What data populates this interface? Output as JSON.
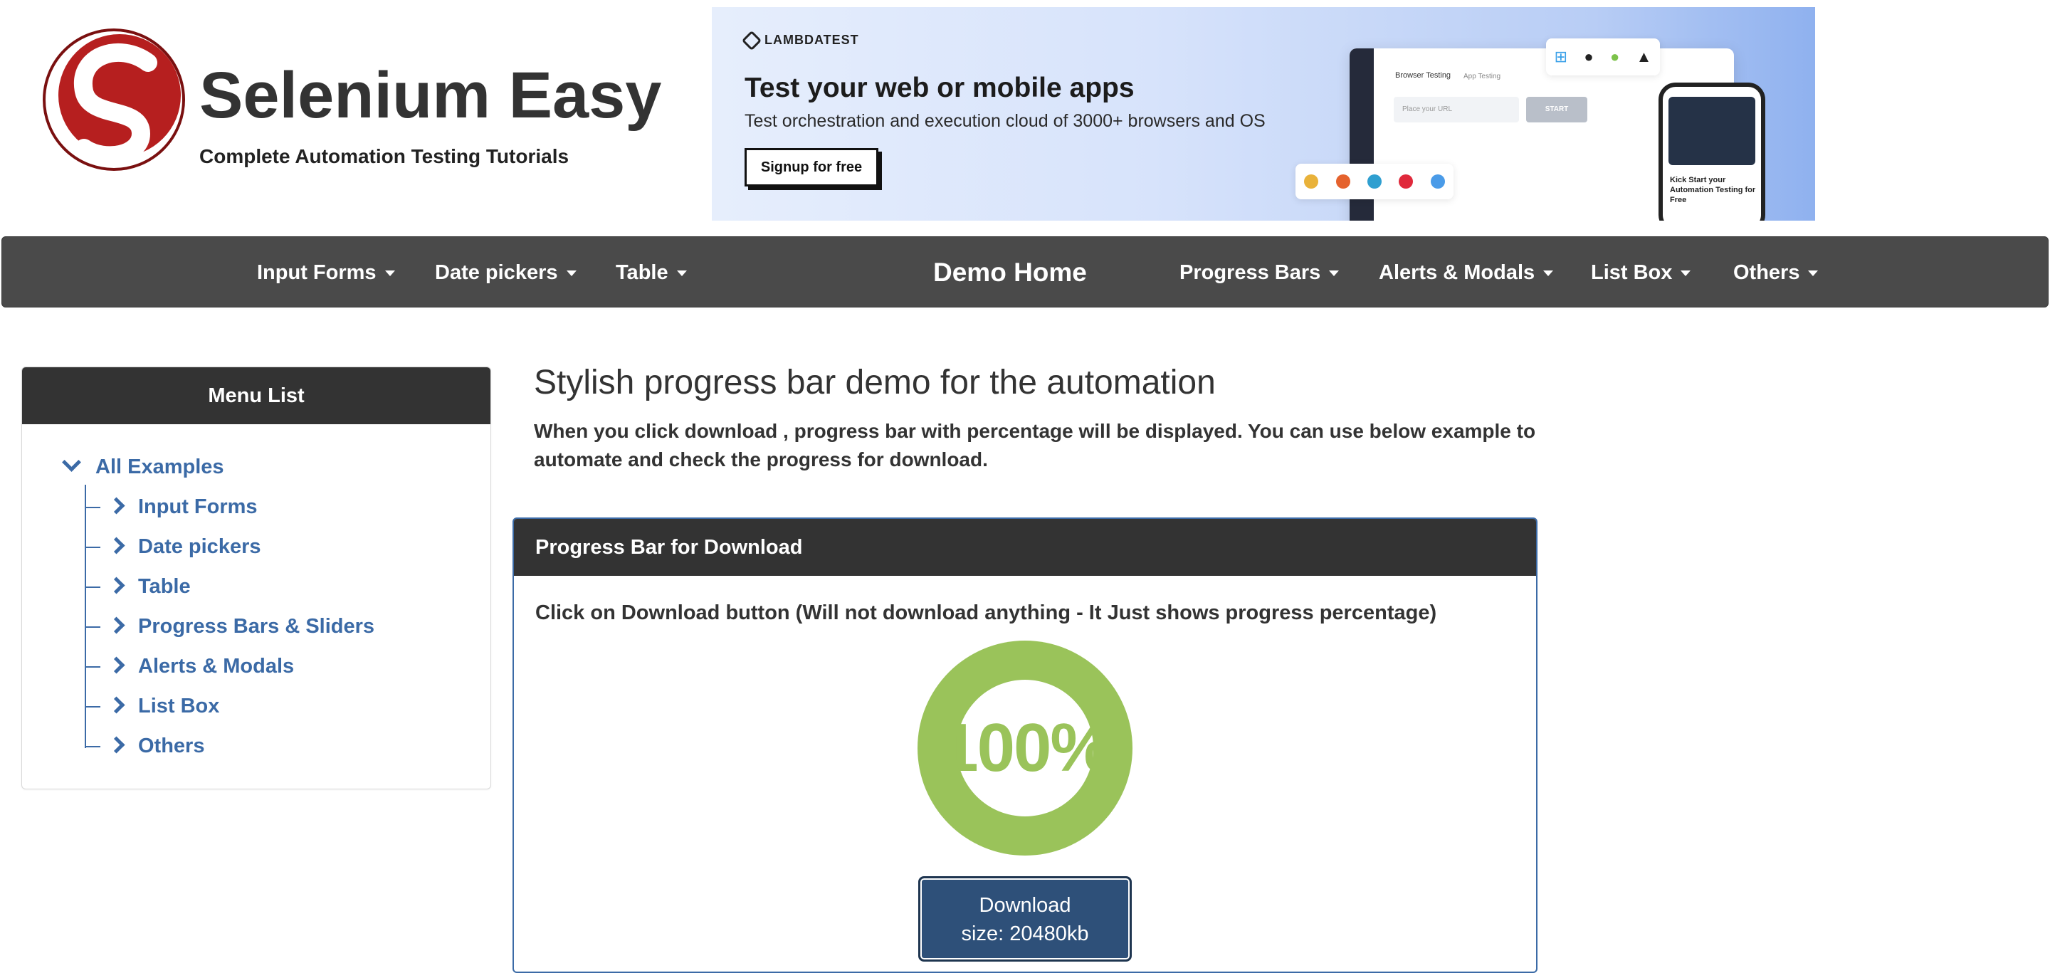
{
  "header": {
    "brand_title": "Selenium Easy",
    "brand_subtitle": "Complete Automation Testing Tutorials"
  },
  "ad": {
    "brand": "LAMBDATEST",
    "headline": "Test your web or mobile apps",
    "text": "Test orchestration and execution cloud of 3000+ browsers and OS",
    "cta": "Signup for free",
    "mock_tab_1": "Browser Testing",
    "mock_tab_2": "App Testing",
    "mock_url_placeholder": "Place your URL",
    "mock_start": "START",
    "phone_text": "Kick Start your Automation Testing for Free"
  },
  "nav": {
    "items_left": [
      "Input Forms",
      "Date pickers",
      "Table"
    ],
    "home": "Demo Home",
    "items_right": [
      "Progress Bars",
      "Alerts & Modals",
      "List Box",
      "Others"
    ]
  },
  "sidebar": {
    "title": "Menu List",
    "root": "All Examples",
    "items": [
      "Input Forms",
      "Date pickers",
      "Table",
      "Progress Bars & Sliders",
      "Alerts & Modals",
      "List Box",
      "Others"
    ]
  },
  "main": {
    "title": "Stylish progress bar demo for the automation",
    "description": "When you click download , progress bar with percentage will be displayed. You can use below example to automate and check the progress for download."
  },
  "panel": {
    "title": "Progress Bar for Download",
    "instruction": "Click on Download button (Will not download anything - It Just shows progress percentage)",
    "progress_label": "100%",
    "progress_percent": 100,
    "button_line1": "Download",
    "button_line2": "size: 20480kb"
  },
  "colors": {
    "accent": "#3b6aa6",
    "progress": "#9ac35a",
    "navbar": "#4a4a4a",
    "button": "#2e5079"
  }
}
